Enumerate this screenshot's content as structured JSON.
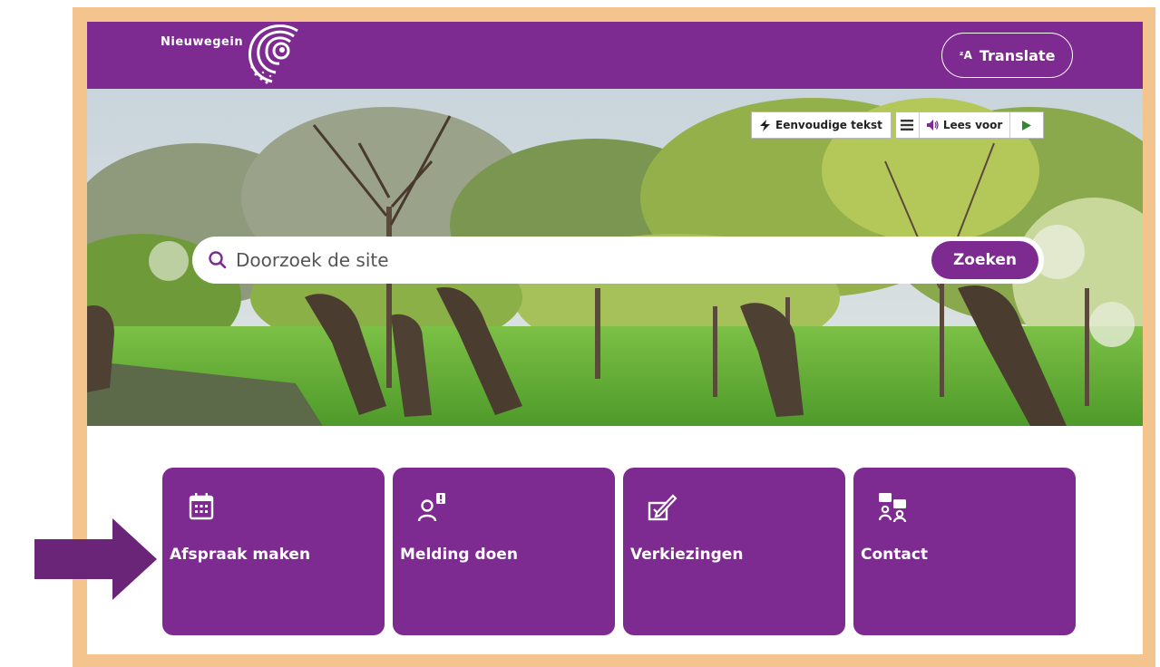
{
  "header": {
    "logo_text": "Nieuwegein",
    "translate_label": "Translate",
    "translate_icon": "translate-icon"
  },
  "readspeaker": {
    "simple_text_label": "Eenvoudige tekst",
    "read_aloud_label": "Lees voor"
  },
  "search": {
    "placeholder": "Doorzoek de site",
    "button_label": "Zoeken"
  },
  "tiles": [
    {
      "label": "Afspraak maken",
      "icon": "calendar-icon"
    },
    {
      "label": "Melding doen",
      "icon": "person-alert-icon"
    },
    {
      "label": "Verkiezingen",
      "icon": "ballot-pen-icon"
    },
    {
      "label": "Contact",
      "icon": "contact-chat-icon"
    }
  ],
  "colors": {
    "brand_purple": "#7e2b91",
    "frame_orange": "#f4c48e",
    "arrow_purple": "#6a2478"
  }
}
